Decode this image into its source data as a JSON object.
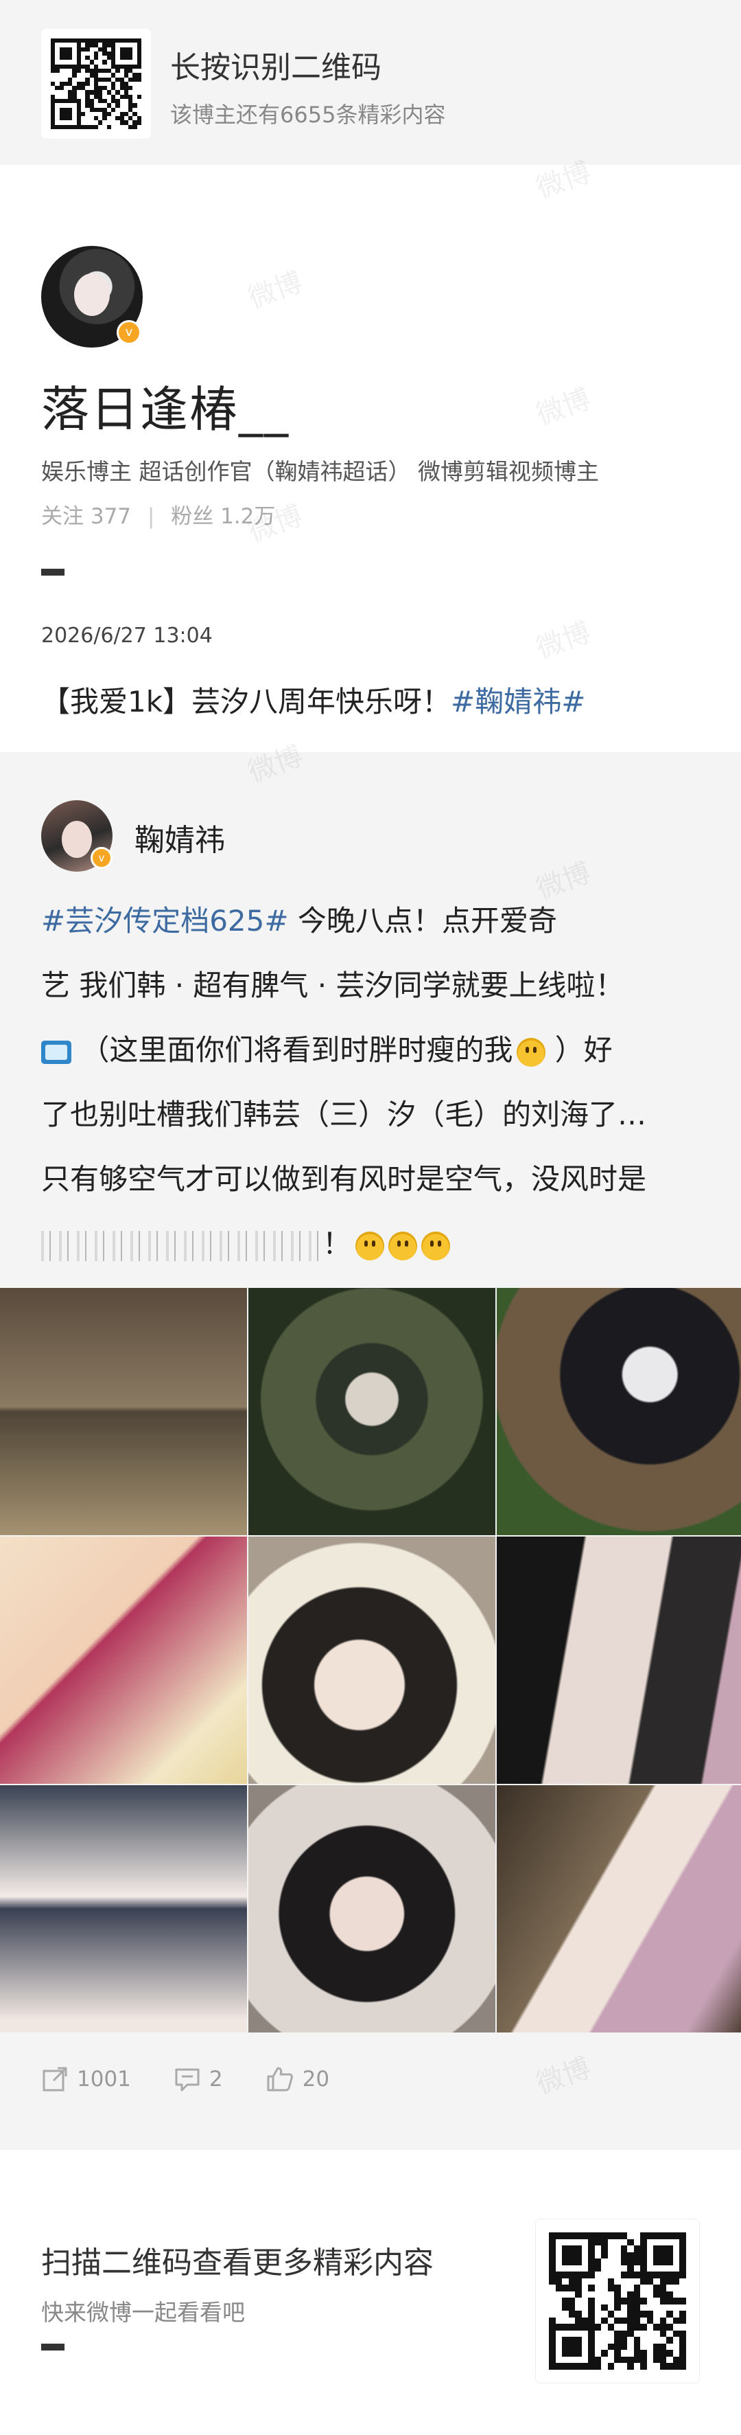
{
  "header": {
    "title": "长按识别二维码",
    "subtitle": "该博主还有6655条精彩内容"
  },
  "profile": {
    "name": "落日逢椿__",
    "tags": "娱乐博主  超话创作官（鞠婧祎超话）  微博剪辑视频博主",
    "following_label": "关注",
    "following": "377",
    "followers_label": "粉丝",
    "followers": "1.2万",
    "post_date": "2026/6/27  13:04",
    "post_text": "【我爱1k】芸汐八周年快乐呀！",
    "post_tag": "#鞠婧祎#"
  },
  "repost": {
    "author": "鞠婧祎",
    "hashtag": "#芸汐传定档625#",
    "line1_rest": "  今晚八点！点开爱奇",
    "line2": "艺    我们韩 · 超有脾气 · 芸汐同学就要上线啦！",
    "line3": " （这里面你们将看到时胖时瘦的我",
    "line3_end": " ）好",
    "line4": "了也别吐槽我们韩芸（三）汐（毛）的刘海了…",
    "line5": "只有够空气才可以做到有风时是空气，没风时是",
    "line6_end": "！"
  },
  "actions": {
    "repost_count": "1001",
    "comment_count": "2",
    "like_count": "20"
  },
  "footer": {
    "title": "扫描二维码查看更多精彩内容",
    "subtitle": "快来微博一起看看吧"
  },
  "watermark": "微博",
  "colors": {
    "hashtag": "#3d6aa0",
    "badge": "#f6a623",
    "muted": "#999999"
  },
  "icons": [
    "qr-code-icon",
    "verified-badge-icon",
    "tv-emoji-icon",
    "smile-emoji-icon",
    "repost-icon",
    "comment-icon",
    "like-icon"
  ]
}
